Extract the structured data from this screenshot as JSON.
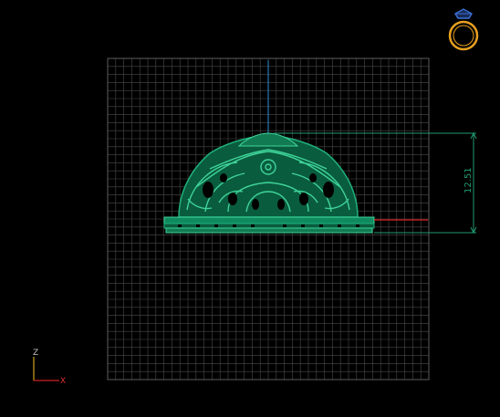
{
  "viewport": {
    "view_name": "front-view",
    "background": "#000000",
    "grid_color": "#4a4a4a",
    "model_color": "#0f8a5e",
    "model_highlight": "#3fd49a",
    "dimension_color": "#1f9a6e",
    "vertical_axis_color": "#2a8fd0",
    "horizontal_axis_color": "#d62020"
  },
  "dimension": {
    "value": "12.51",
    "orientation": "vertical"
  },
  "axis_gizmo": {
    "vertical_label": "Z",
    "horizontal_label": "X",
    "vertical_color": "#d0a020",
    "horizontal_color": "#d02020",
    "x_label_color": "#e03030",
    "z_label_color": "#c0c0c0"
  },
  "ring_icon": {
    "name": "ring-icon",
    "color": "#e8a020",
    "gem_color": "#3a70d8"
  }
}
